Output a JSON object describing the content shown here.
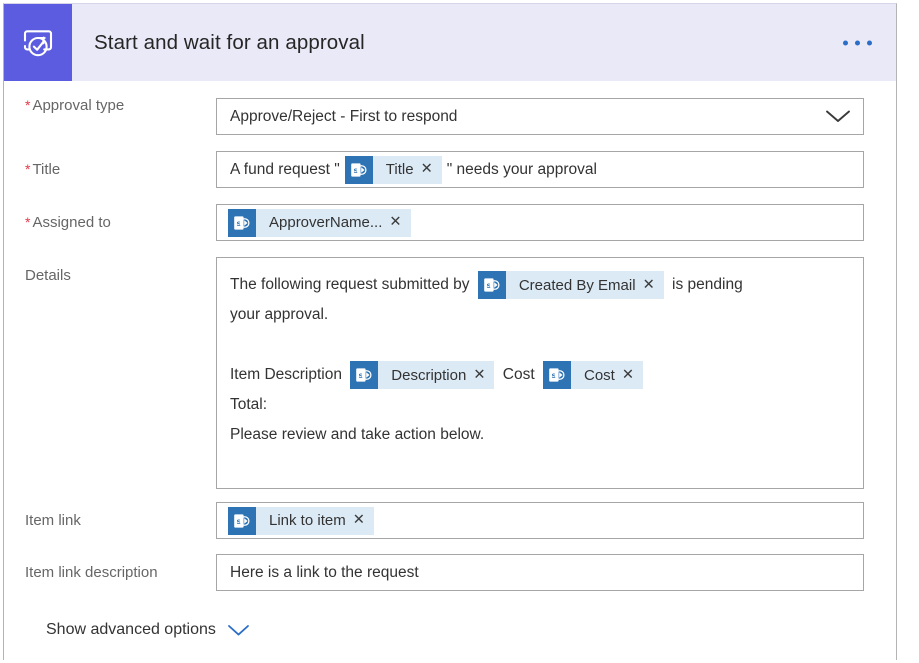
{
  "header": {
    "title": "Start and wait for an approval",
    "icon": "approval-check-arrow-icon",
    "menu_label": "...",
    "icon_bg": "#5c5ce0",
    "bar_bg": "#e9e9f8"
  },
  "colors": {
    "required_star": "#e8374a",
    "label": "#666666",
    "chip_bg": "#dceaf6",
    "chip_icon_bg": "#2e74b5",
    "accent_blue": "#2c6ec6",
    "field_border": "#a6a6a6"
  },
  "fields": {
    "approval_type": {
      "label": "Approval type",
      "required": true,
      "value": "Approve/Reject - First to respond",
      "chevron": "chevron-down-icon"
    },
    "title": {
      "label": "Title",
      "required": true,
      "text_before": "A fund request \"",
      "token": "Title",
      "text_after": "\" needs your approval"
    },
    "assigned_to": {
      "label": "Assigned to",
      "required": true,
      "token": "ApproverName..."
    },
    "details": {
      "label": "Details",
      "required": false,
      "line1_before": "The following request submitted by",
      "line1_token": "Created By Email",
      "line1_after": "is pending",
      "line2": "your approval.",
      "line4_before": "Item Description",
      "line4_token1": "Description",
      "line4_mid": "Cost",
      "line4_token2": "Cost",
      "line5": "Total:",
      "line6": "Please review and take action below."
    },
    "item_link": {
      "label": "Item link",
      "required": false,
      "token": "Link to item"
    },
    "item_link_description": {
      "label": "Item link description",
      "required": false,
      "value": "Here is a link to the request"
    }
  },
  "advanced": {
    "label": "Show advanced options",
    "icon": "chevron-down-icon"
  },
  "chip_remove_glyph": "✕",
  "chip_icon_name": "sharepoint-icon"
}
